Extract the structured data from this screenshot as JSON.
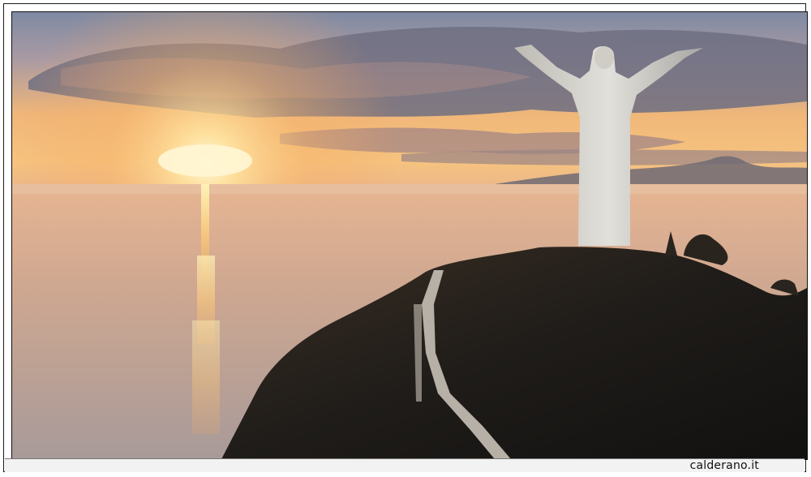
{
  "photo": {
    "subject": "statue-on-mountain-at-sunset"
  },
  "footer": {
    "credit": "calderano.it"
  },
  "colors": {
    "sky_top": "#8a93a6",
    "sun": "#ffe9a8",
    "sea": "#c9a98f",
    "rock": "#1c1a17",
    "statue": "#d9d7d2"
  }
}
